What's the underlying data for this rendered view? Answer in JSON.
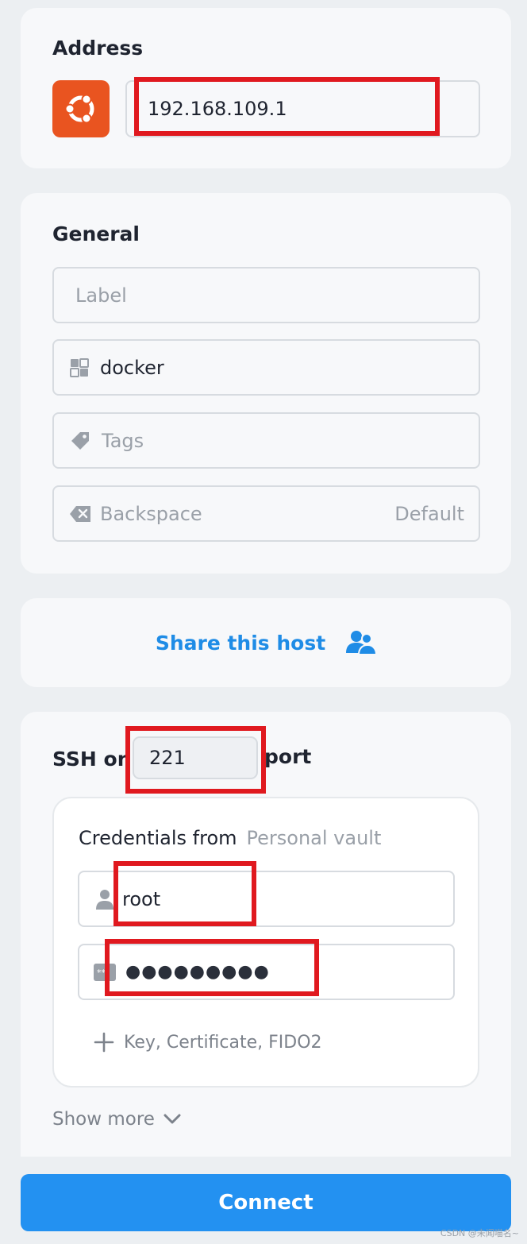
{
  "address": {
    "title": "Address",
    "os_icon": "ubuntu-icon",
    "value": "192.168.109.1"
  },
  "general": {
    "title": "General",
    "label_placeholder": "Label",
    "group_value": "docker",
    "group_icon": "group-icon",
    "tags_placeholder": "Tags",
    "tags_icon": "tag-icon",
    "backspace_label": "Backspace",
    "backspace_icon": "backspace-icon",
    "backspace_value": "Default"
  },
  "share": {
    "label": "Share this host",
    "icon": "users-icon",
    "color": "#1f8ce6"
  },
  "ssh": {
    "prefix": "SSH on",
    "port": "221",
    "suffix": "port"
  },
  "credentials": {
    "title": "Credentials from",
    "vault": "Personal vault",
    "username": "root",
    "user_icon": "user-icon",
    "password": "●●●●●●●●●",
    "password_icon": "password-icon",
    "add_key_label": "Key, Certificate, FIDO2",
    "add_icon": "plus-icon"
  },
  "show_more": {
    "label": "Show more",
    "icon": "chevron-down-icon"
  },
  "connect": {
    "label": "Connect",
    "color": "#2391f1"
  },
  "footer": {
    "credit": "CSDN @未闻喵名~"
  },
  "colors": {
    "annotation_red": "#e0191f",
    "ubuntu_orange": "#e95420"
  }
}
